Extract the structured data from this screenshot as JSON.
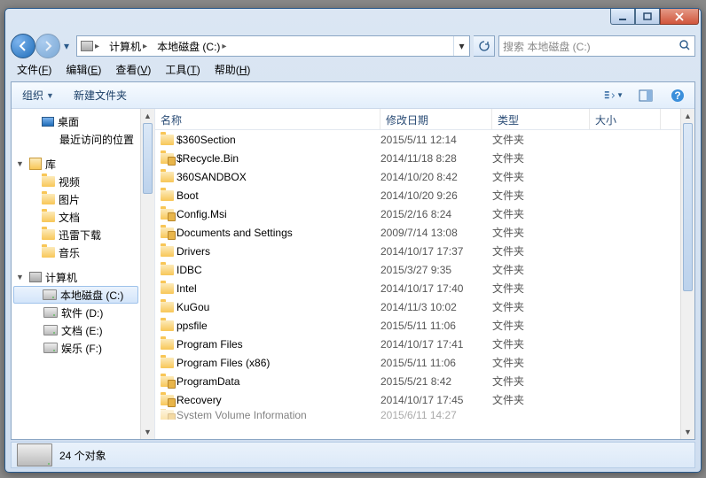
{
  "address": {
    "root_icon": "computer-icon",
    "segments": [
      "计算机",
      "本地磁盘 (C:)"
    ]
  },
  "search": {
    "placeholder": "搜索 本地磁盘 (C:)"
  },
  "menubar": [
    {
      "label": "文件",
      "accel": "F"
    },
    {
      "label": "编辑",
      "accel": "E"
    },
    {
      "label": "查看",
      "accel": "V"
    },
    {
      "label": "工具",
      "accel": "T"
    },
    {
      "label": "帮助",
      "accel": "H"
    }
  ],
  "toolbar": {
    "organize": "组织",
    "newfolder": "新建文件夹"
  },
  "nav": {
    "quick": [
      {
        "icon": "desktop",
        "label": "桌面"
      },
      {
        "icon": "recent",
        "label": "最近访问的位置"
      }
    ],
    "libraries_label": "库",
    "libraries": [
      {
        "icon": "video",
        "label": "视频"
      },
      {
        "icon": "pictures",
        "label": "图片"
      },
      {
        "icon": "documents",
        "label": "文档"
      },
      {
        "icon": "downloads",
        "label": "迅雷下载"
      },
      {
        "icon": "music",
        "label": "音乐"
      }
    ],
    "computer_label": "计算机",
    "drives": [
      {
        "label": "本地磁盘 (C:)",
        "selected": true
      },
      {
        "label": "软件 (D:)"
      },
      {
        "label": "文档 (E:)"
      },
      {
        "label": "娱乐 (F:)"
      }
    ]
  },
  "columns": {
    "name": "名称",
    "date": "修改日期",
    "type": "类型",
    "size": "大小"
  },
  "folder_type": "文件夹",
  "items": [
    {
      "name": "$360Section",
      "date": "2015/5/11 12:14",
      "locked": false
    },
    {
      "name": "$Recycle.Bin",
      "date": "2014/11/18 8:28",
      "locked": true
    },
    {
      "name": "360SANDBOX",
      "date": "2014/10/20 8:42",
      "locked": false
    },
    {
      "name": "Boot",
      "date": "2014/10/20 9:26",
      "locked": false
    },
    {
      "name": "Config.Msi",
      "date": "2015/2/16 8:24",
      "locked": true
    },
    {
      "name": "Documents and Settings",
      "date": "2009/7/14 13:08",
      "locked": true
    },
    {
      "name": "Drivers",
      "date": "2014/10/17 17:37",
      "locked": false
    },
    {
      "name": "IDBC",
      "date": "2015/3/27 9:35",
      "locked": false
    },
    {
      "name": "Intel",
      "date": "2014/10/17 17:40",
      "locked": false
    },
    {
      "name": "KuGou",
      "date": "2014/11/3 10:02",
      "locked": false
    },
    {
      "name": "ppsfile",
      "date": "2015/5/11 11:06",
      "locked": false
    },
    {
      "name": "Program Files",
      "date": "2014/10/17 17:41",
      "locked": false
    },
    {
      "name": "Program Files (x86)",
      "date": "2015/5/11 11:06",
      "locked": false
    },
    {
      "name": "ProgramData",
      "date": "2015/5/21 8:42",
      "locked": true
    },
    {
      "name": "Recovery",
      "date": "2014/10/17 17:45",
      "locked": true
    }
  ],
  "overflow_item": {
    "name": "System Volume Information",
    "date": "2015/6/11 14:27"
  },
  "status": {
    "count_text": "24 个对象"
  }
}
